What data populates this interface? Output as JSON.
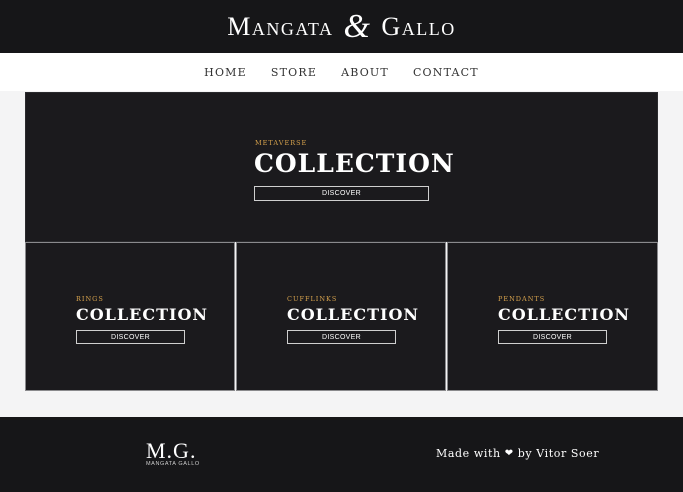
{
  "header": {
    "logo_left": "Mangata",
    "logo_amp": "&",
    "logo_right": "Gallo"
  },
  "nav": {
    "items": [
      "HOME",
      "STORE",
      "ABOUT",
      "CONTACT"
    ]
  },
  "hero": {
    "eyebrow": "METAVERSE",
    "title": "COLLECTION",
    "button": "DISCOVER"
  },
  "tiles": [
    {
      "eyebrow": "RINGS",
      "title": "COLLECTION",
      "button": "DISCOVER"
    },
    {
      "eyebrow": "CUFFLINKS",
      "title": "COLLECTION",
      "button": "DISCOVER"
    },
    {
      "eyebrow": "PENDANTS",
      "title": "COLLECTION",
      "button": "DISCOVER"
    }
  ],
  "footer": {
    "monogram": "M.G.",
    "monogram_sub": "MANGATA GALLO",
    "credit_prefix": "Made with",
    "credit_icon": "heart-icon",
    "credit_suffix": "by Vitor Soer"
  },
  "colors": {
    "dark": "#161618",
    "panel": "#1b1a1d",
    "accent": "#d6a24d"
  }
}
